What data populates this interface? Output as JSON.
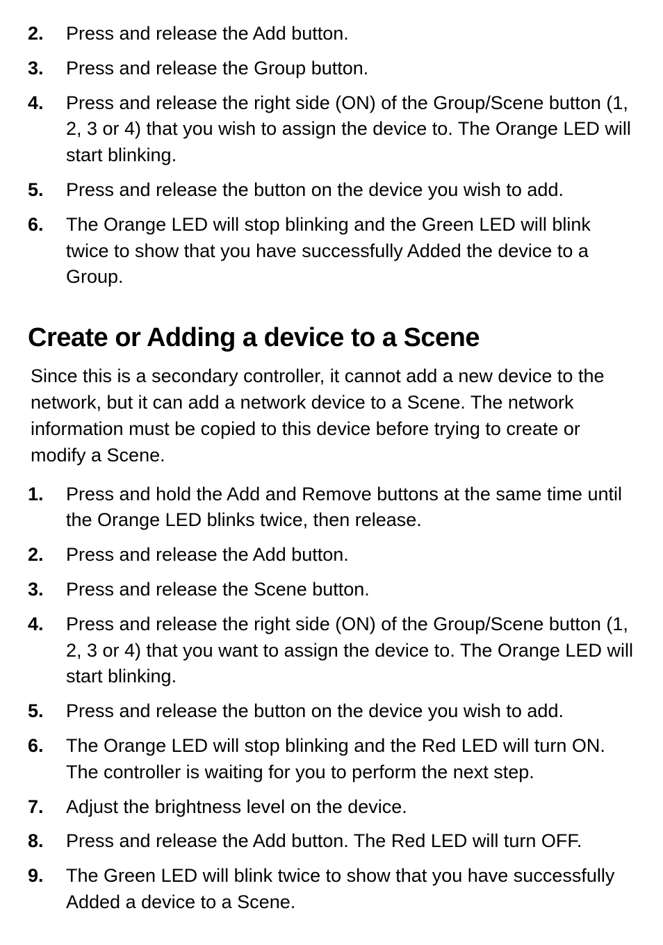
{
  "list1": {
    "items": [
      {
        "num": "2.",
        "text": "Press and release the Add button."
      },
      {
        "num": "3.",
        "text": "Press and release the Group button."
      },
      {
        "num": "4.",
        "text": "Press and release the right side (ON) of the Group/Scene button (1, 2, 3 or 4) that you wish to assign the device to.  The Orange LED will start blinking."
      },
      {
        "num": "5.",
        "text": "Press and release the button on the device you wish to add."
      },
      {
        "num": "6.",
        "text": "The Orange LED will stop blinking and the Green LED will blink twice to show that you have successfully Added the device to a Group."
      }
    ]
  },
  "heading": "Create or Adding a device to a Scene",
  "intro": "Since this is a secondary controller, it cannot add a new device to the network, but it can add a network device to a Scene.  The network information must be copied to this device before trying to create or modify a Scene.",
  "list2": {
    "items": [
      {
        "num": "1.",
        "text": "Press and hold the Add and Remove buttons at the same time until the Orange LED blinks twice, then release."
      },
      {
        "num": "2.",
        "text": "Press and release the Add button."
      },
      {
        "num": "3.",
        "text": "Press and release the Scene button."
      },
      {
        "num": "4.",
        "text": "Press and release the right side (ON) of the Group/Scene button (1, 2, 3 or 4) that you want to assign the device to. The Orange LED will start blinking."
      },
      {
        "num": "5.",
        "text": "Press and release the button on the device you wish to add."
      },
      {
        "num": "6.",
        "text": "The Orange LED will stop blinking and the Red LED will turn ON.  The controller is waiting for you to perform the next step."
      },
      {
        "num": "7.",
        "text": "Adjust the brightness level on the device."
      },
      {
        "num": "8.",
        "text": "Press and release the Add button. The Red LED will turn OFF."
      },
      {
        "num": "9.",
        "text": "The Green LED will blink twice to show that you have successfully Added a device to a Scene."
      }
    ]
  }
}
